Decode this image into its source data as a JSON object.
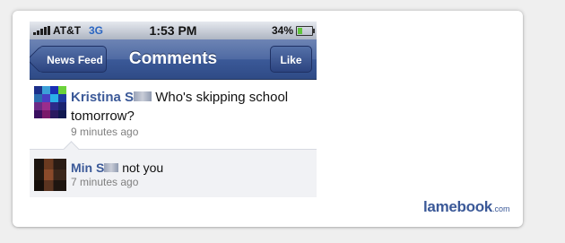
{
  "status_bar": {
    "carrier": "AT&T",
    "network": "3G",
    "time": "1:53 PM",
    "battery": "34%",
    "battery_level": 0.34,
    "signal_bars": 5
  },
  "nav": {
    "back_label": "News Feed",
    "title": "Comments",
    "like_label": "Like"
  },
  "comments": [
    {
      "author": "Kristina S",
      "text": " Who's skipping school tomorrow?",
      "time": "9 minutes ago"
    },
    {
      "author": "Min S",
      "text": " not you",
      "time": "7 minutes ago"
    }
  ],
  "watermark": {
    "brand": "lamebook",
    "domain": ".com"
  },
  "colors": {
    "facebook_blue": "#3b5998",
    "battery_green": "#5fc43b"
  }
}
